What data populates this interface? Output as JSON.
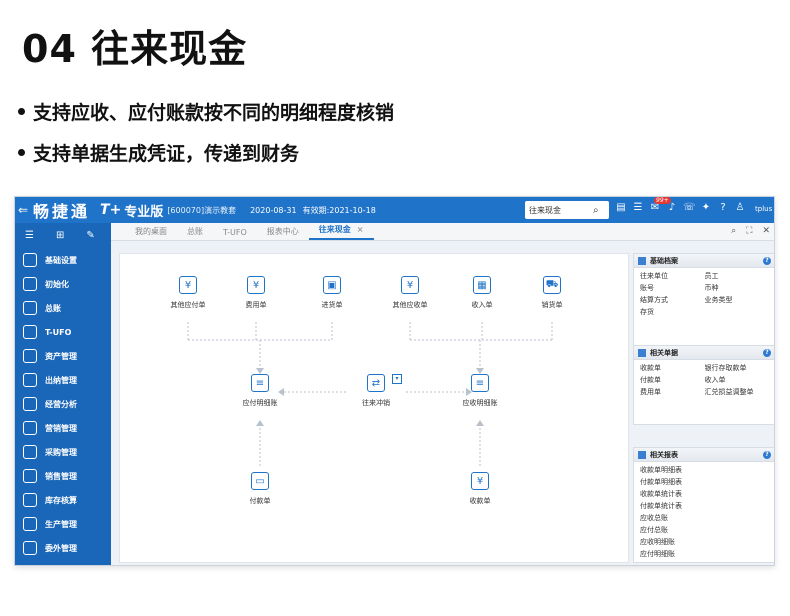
{
  "slide": {
    "title": "04 往来现金",
    "bullets": [
      "支持应收、应付账款按不同的明细程度核销",
      "支持单据生成凭证，传递到财务"
    ]
  },
  "app": {
    "brand": "畅捷通",
    "edition": "T+",
    "edition_suffix": "专业版",
    "account": "[600070]演示教套",
    "date": "2020-08-31",
    "valid": "有效期:2021-10-18",
    "search_value": "往来现金",
    "badge": "99+",
    "user": "tplus",
    "colors": {
      "brand_blue": "#1f73c9",
      "sidebar_blue": "#1a66b8"
    }
  },
  "sidebar": {
    "items": [
      {
        "label": "基础设置",
        "icon": "gear-icon"
      },
      {
        "label": "初始化",
        "icon": "refresh-icon"
      },
      {
        "label": "总账",
        "icon": "ledger-icon"
      },
      {
        "label": "T-UFO",
        "icon": "report-icon"
      },
      {
        "label": "资产管理",
        "icon": "bank-icon"
      },
      {
        "label": "出纳管理",
        "icon": "cashier-icon"
      },
      {
        "label": "经营分析",
        "icon": "analysis-icon"
      },
      {
        "label": "营销管理",
        "icon": "chart-icon"
      },
      {
        "label": "采购管理",
        "icon": "cart-icon"
      },
      {
        "label": "销售管理",
        "icon": "sales-icon"
      },
      {
        "label": "库存核算",
        "icon": "warehouse-icon"
      },
      {
        "label": "生产管理",
        "icon": "production-icon"
      },
      {
        "label": "委外管理",
        "icon": "outsource-icon"
      }
    ]
  },
  "tabs": [
    "我的桌面",
    "总账",
    "T-UFO",
    "报表中心",
    "往来现金"
  ],
  "flow": {
    "nodes": {
      "other_payable": "其他应付单",
      "expense": "费用单",
      "purchase": "进货单",
      "other_receivable": "其他应收单",
      "income": "收入单",
      "sales": "销货单",
      "payable_detail": "应付明细账",
      "offset": "往来冲销",
      "receivable_detail": "应收明细账",
      "payment": "付款单",
      "receipt": "收款单"
    }
  },
  "panels": {
    "basic": {
      "title": "基础档案",
      "items": [
        "往来单位",
        "员工",
        "账号",
        "币种",
        "结算方式",
        "业务类型",
        "存货",
        ""
      ]
    },
    "docs": {
      "title": "相关单据",
      "items": [
        "收款单",
        "银行存取款单",
        "付款单",
        "收入单",
        "费用单",
        "汇兑损益调整单"
      ]
    },
    "reports": {
      "title": "相关报表",
      "items": [
        "收款单明细表",
        "付款单明细表",
        "收款单统计表",
        "付款单统计表",
        "应收总账",
        "应付总账",
        "应收明细账",
        "应付明细账"
      ]
    }
  }
}
